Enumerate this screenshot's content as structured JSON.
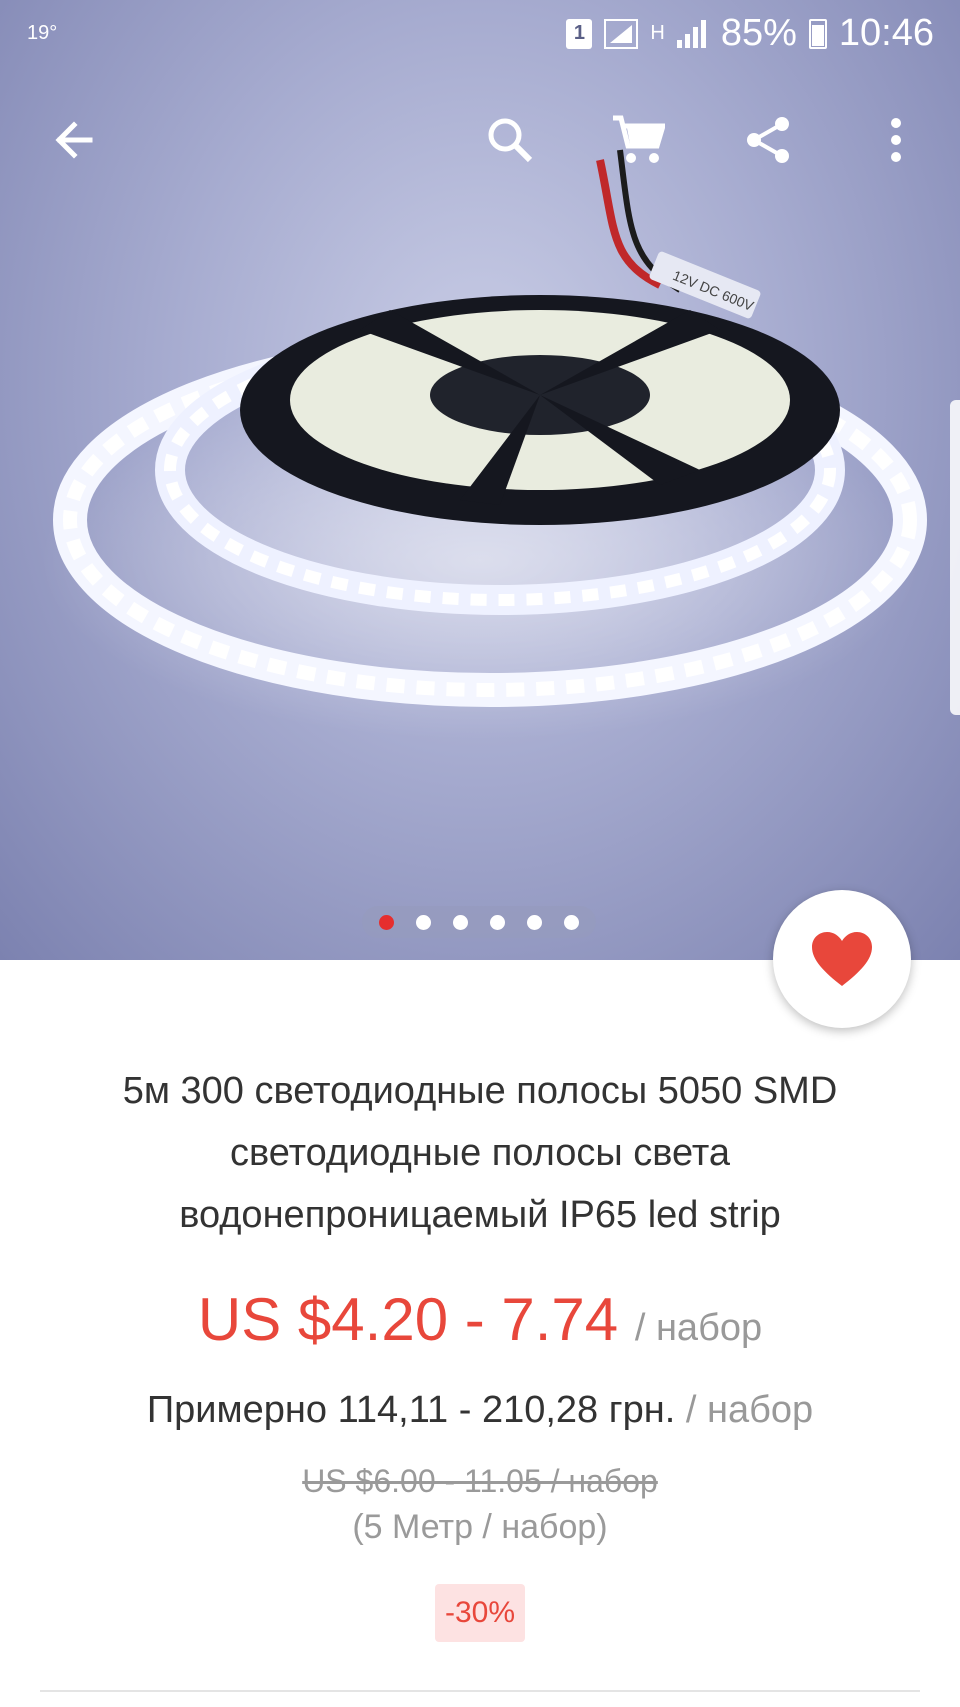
{
  "status_bar": {
    "temperature": "19°",
    "sim": "1",
    "network_type": "H",
    "battery": "85%",
    "time": "10:46"
  },
  "toolbar": {
    "back_icon": "arrow-left-icon",
    "search_icon": "search-icon",
    "cart_icon": "cart-icon",
    "share_icon": "share-icon",
    "more_icon": "more-vertical-icon"
  },
  "gallery": {
    "slide_count": 6,
    "active_index": 0,
    "strip_label": "12V DC 600V"
  },
  "product": {
    "title": "5м 300 светодиодные полосы 5050 SMD светодиодные полосы света водонепроницаемый IP65 led strip",
    "price": "US $4.20 - 7.74",
    "price_unit": "/ набор",
    "approx_price": "Примерно 114,11 - 210,28 грн.",
    "approx_unit": "/ набор",
    "old_price": "US $6.00 - 11.05 / набор",
    "pack_info": "(5 Метр / набор)",
    "discount": "-30%"
  },
  "colors": {
    "accent_red": "#e8473b",
    "text_dark": "#333333",
    "text_gray": "#999999"
  }
}
